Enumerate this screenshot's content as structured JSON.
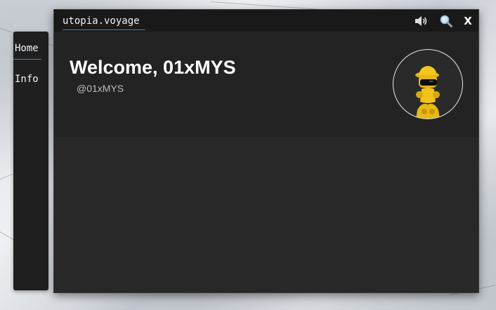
{
  "window": {
    "title": "utopia.voyage",
    "sound_icon": "speaker-icon",
    "search_icon": "magnifier-icon",
    "close_label": "X"
  },
  "sidebar": {
    "items": [
      {
        "label": "Home",
        "active": true
      },
      {
        "label": "Info",
        "active": false
      }
    ]
  },
  "profile": {
    "welcome": "Welcome, 01xMYS",
    "handle": "@01xMYS",
    "avatar_icon": "user-avatar"
  },
  "colors": {
    "accent": "#3a86c8",
    "window_bg": "#282828",
    "titlebar_bg": "#191919",
    "header_bg": "#232323"
  }
}
